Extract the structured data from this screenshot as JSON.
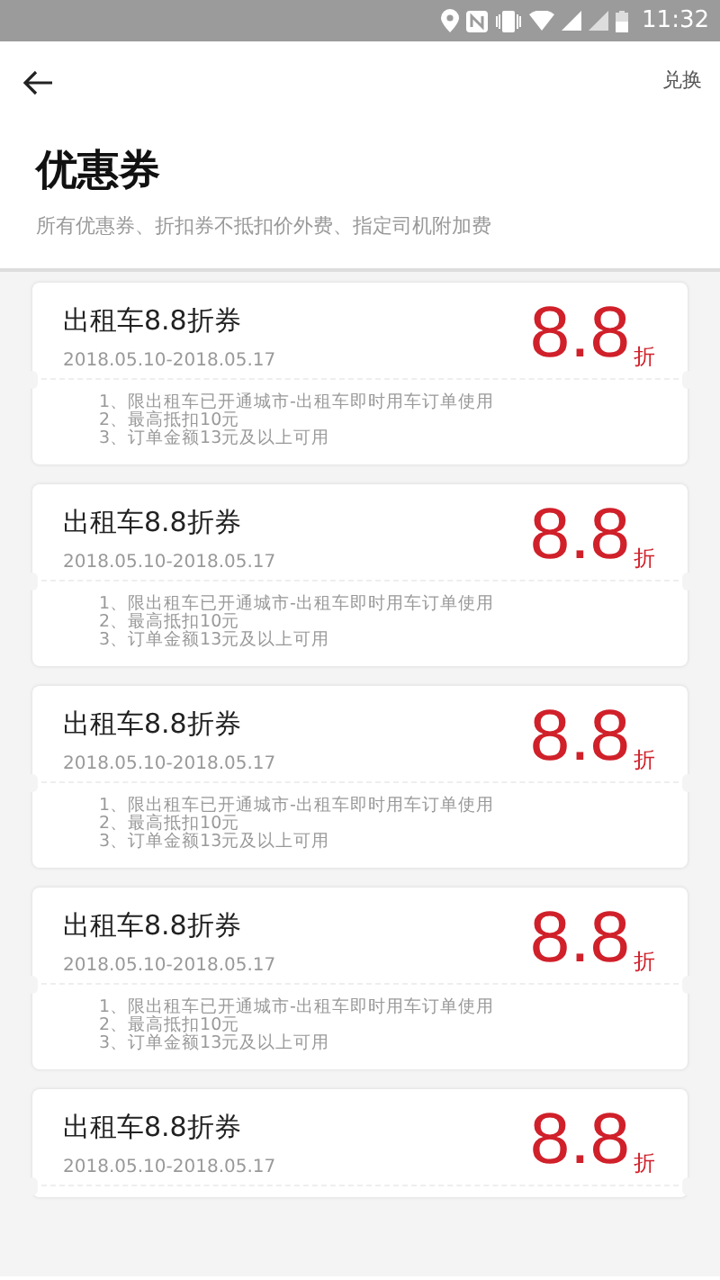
{
  "status_bar": {
    "time": "11:32"
  },
  "header": {
    "action": "兑换"
  },
  "title": "优惠券",
  "subtitle": "所有优惠券、折扣券不抵扣价外费、指定司机附加费",
  "coupons": [
    {
      "title": "出租车8.8折券",
      "date": "2018.05.10-2018.05.17",
      "value": "8.8",
      "unit": "折",
      "rules": [
        "1、限出租车已开通城市-出租车即时用车订单使用",
        "2、最高抵扣10元",
        "3、订单金额13元及以上可用"
      ]
    },
    {
      "title": "出租车8.8折券",
      "date": "2018.05.10-2018.05.17",
      "value": "8.8",
      "unit": "折",
      "rules": [
        "1、限出租车已开通城市-出租车即时用车订单使用",
        "2、最高抵扣10元",
        "3、订单金额13元及以上可用"
      ]
    },
    {
      "title": "出租车8.8折券",
      "date": "2018.05.10-2018.05.17",
      "value": "8.8",
      "unit": "折",
      "rules": [
        "1、限出租车已开通城市-出租车即时用车订单使用",
        "2、最高抵扣10元",
        "3、订单金额13元及以上可用"
      ]
    },
    {
      "title": "出租车8.8折券",
      "date": "2018.05.10-2018.05.17",
      "value": "8.8",
      "unit": "折",
      "rules": [
        "1、限出租车已开通城市-出租车即时用车订单使用",
        "2、最高抵扣10元",
        "3、订单金额13元及以上可用"
      ]
    },
    {
      "title": "出租车8.8折券",
      "date": "2018.05.10-2018.05.17",
      "value": "8.8",
      "unit": "折"
    }
  ]
}
